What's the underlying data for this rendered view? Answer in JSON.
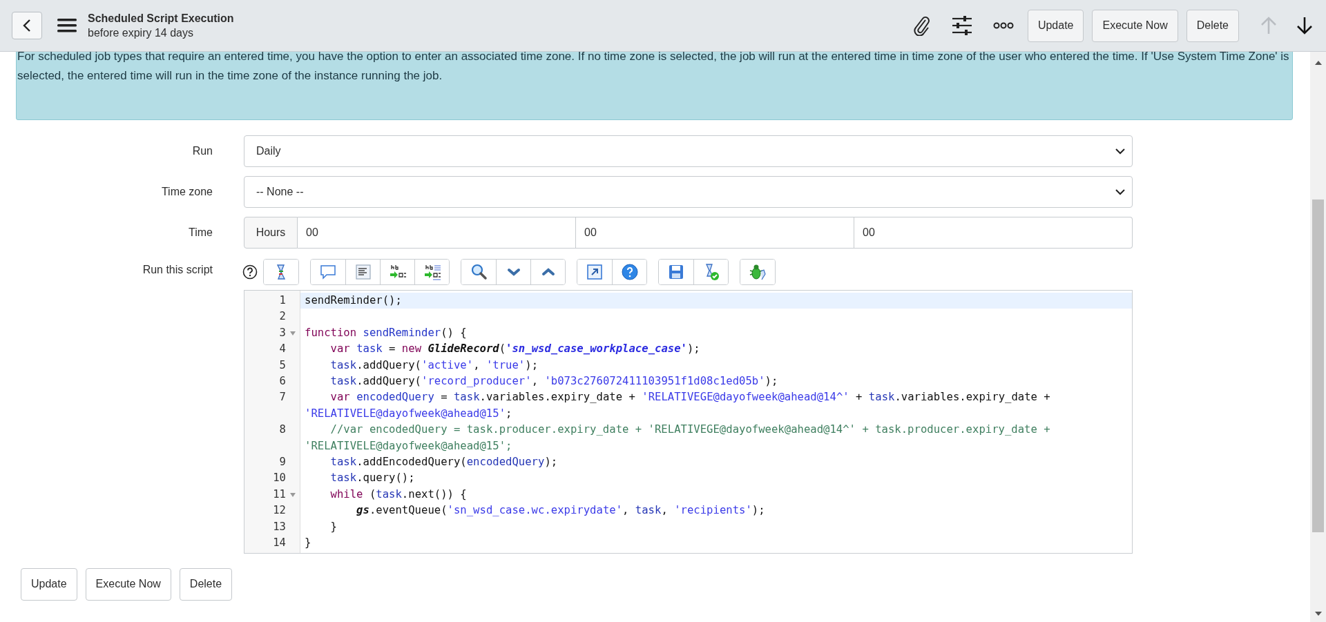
{
  "header": {
    "title": "Scheduled Script Execution",
    "subtitle": "before expiry 14 days",
    "actions": [
      {
        "label": "Update"
      },
      {
        "label": "Execute Now"
      },
      {
        "label": "Delete"
      }
    ],
    "nav": [
      {
        "kind": "up",
        "disabled": true
      },
      {
        "kind": "down",
        "disabled": false
      }
    ]
  },
  "info_banner": "For scheduled job types that require an entered time, you have the option to enter an associated time zone. If no time zone is selected, the job will run at the entered time in time zone of the user who entered the time. If 'Use System Time Zone' is selected, the entered time will run in the time zone of the instance running the job.",
  "fields": [
    {
      "kind": "select",
      "label": "Run",
      "value": "Daily"
    },
    {
      "kind": "select",
      "label": "Time zone",
      "value": "-- None --"
    },
    {
      "kind": "time",
      "label": "Time",
      "prefix": "Hours",
      "values": [
        "00",
        "00",
        "00"
      ]
    }
  ],
  "script": {
    "label": "Run this script",
    "lines": [
      {
        "number": "1",
        "active": true,
        "foldable": false,
        "tokens": [
          {
            "kind": "plain",
            "text": "sendReminder();"
          }
        ]
      },
      {
        "number": "2",
        "active": false,
        "foldable": false
      },
      {
        "number": "3",
        "active": false,
        "foldable": true,
        "tokens": [
          {
            "kind": "keyword",
            "text": "function "
          },
          {
            "kind": "name",
            "text": "sendReminder"
          },
          {
            "kind": "plain",
            "text": "() {"
          }
        ]
      },
      {
        "number": "4",
        "active": false,
        "foldable": false,
        "tokens": [
          {
            "kind": "keyword",
            "text": "    var "
          },
          {
            "kind": "name",
            "text": "task"
          },
          {
            "kind": "plain",
            "text": " = "
          },
          {
            "kind": "keyword",
            "text": "new "
          },
          {
            "kind": "type",
            "text": "GlideRecord"
          },
          {
            "kind": "plain",
            "text": "("
          },
          {
            "kind": "strong_string",
            "text": "'sn_wsd_case_workplace_case'"
          },
          {
            "kind": "plain",
            "text": ");"
          }
        ]
      },
      {
        "number": "5",
        "active": false,
        "foldable": false,
        "tokens": [
          {
            "kind": "variable",
            "text": "    task"
          },
          {
            "kind": "plain",
            "text": ".addQuery("
          },
          {
            "kind": "string",
            "text": "'active'"
          },
          {
            "kind": "plain",
            "text": ", "
          },
          {
            "kind": "string",
            "text": "'true'"
          },
          {
            "kind": "plain",
            "text": ");"
          }
        ]
      },
      {
        "number": "6",
        "active": false,
        "foldable": false,
        "tokens": [
          {
            "kind": "variable",
            "text": "    task"
          },
          {
            "kind": "plain",
            "text": ".addQuery("
          },
          {
            "kind": "string",
            "text": "'record_producer'"
          },
          {
            "kind": "plain",
            "text": ", "
          },
          {
            "kind": "string",
            "text": "'b073c276072411103951f1d08c1ed05b'"
          },
          {
            "kind": "plain",
            "text": ");"
          }
        ]
      },
      {
        "number": "7",
        "active": false,
        "foldable": false,
        "tokens": [
          {
            "kind": "keyword",
            "text": "    var "
          },
          {
            "kind": "name",
            "text": "encodedQuery"
          },
          {
            "kind": "plain",
            "text": " = "
          },
          {
            "kind": "variable",
            "text": "task"
          },
          {
            "kind": "plain",
            "text": ".variables.expiry_date + "
          },
          {
            "kind": "string",
            "text": "'RELATIVEGE@dayofweek@ahead@14^'"
          },
          {
            "kind": "plain",
            "text": " + "
          },
          {
            "kind": "variable",
            "text": "task"
          },
          {
            "kind": "plain",
            "text": ".variables.expiry_date + "
          },
          {
            "kind": "string",
            "text": "'RELATIVELE@dayofweek@ahead@15'"
          },
          {
            "kind": "plain",
            "text": ";"
          }
        ]
      },
      {
        "number": "8",
        "active": false,
        "foldable": false,
        "tokens": [
          {
            "kind": "comment",
            "text": "    //var encodedQuery = task.producer.expiry_date + 'RELATIVEGE@dayofweek@ahead@14^' + task.producer.expiry_date + 'RELATIVELE@dayofweek@ahead@15';"
          }
        ]
      },
      {
        "number": "9",
        "active": false,
        "foldable": false,
        "tokens": [
          {
            "kind": "variable",
            "text": "    task"
          },
          {
            "kind": "plain",
            "text": ".addEncodedQuery("
          },
          {
            "kind": "variable",
            "text": "encodedQuery"
          },
          {
            "kind": "plain",
            "text": ");"
          }
        ]
      },
      {
        "number": "10",
        "active": false,
        "foldable": false,
        "tokens": [
          {
            "kind": "variable",
            "text": "    task"
          },
          {
            "kind": "plain",
            "text": ".query();"
          }
        ]
      },
      {
        "number": "11",
        "active": false,
        "foldable": true,
        "tokens": [
          {
            "kind": "keyword",
            "text": "    while"
          },
          {
            "kind": "plain",
            "text": " ("
          },
          {
            "kind": "variable",
            "text": "task"
          },
          {
            "kind": "plain",
            "text": ".next()) {"
          }
        ]
      },
      {
        "number": "12",
        "active": false,
        "foldable": false,
        "tokens": [
          {
            "kind": "type",
            "text": "        gs"
          },
          {
            "kind": "plain",
            "text": ".eventQueue("
          },
          {
            "kind": "string",
            "text": "'sn_wsd_case.wc.expirydate'"
          },
          {
            "kind": "plain",
            "text": ", "
          },
          {
            "kind": "variable",
            "text": "task"
          },
          {
            "kind": "plain",
            "text": ", "
          },
          {
            "kind": "string",
            "text": "'recipients'"
          },
          {
            "kind": "plain",
            "text": ");"
          }
        ]
      },
      {
        "number": "13",
        "active": false,
        "foldable": false,
        "tokens": [
          {
            "kind": "plain",
            "text": "    }"
          }
        ]
      },
      {
        "number": "14",
        "active": false,
        "foldable": false,
        "tokens": [
          {
            "kind": "plain",
            "text": "}"
          }
        ]
      }
    ]
  },
  "footer_buttons": [
    {
      "label": "Update"
    },
    {
      "label": "Execute Now"
    },
    {
      "label": "Delete"
    }
  ]
}
